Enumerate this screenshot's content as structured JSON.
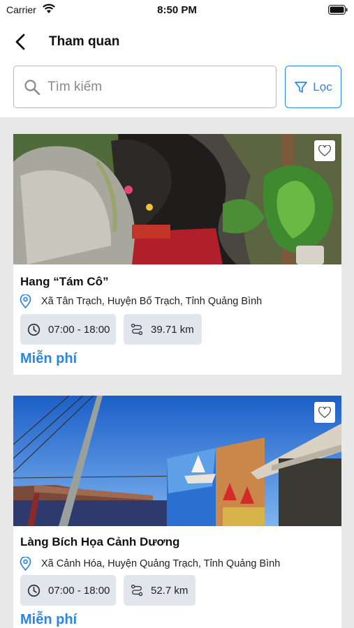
{
  "status_bar": {
    "carrier": "Carrier",
    "time": "8:50 PM"
  },
  "header": {
    "title": "Tham quan"
  },
  "search": {
    "placeholder": "Tìm kiếm",
    "value": ""
  },
  "filter": {
    "label": "Lọc"
  },
  "accent_color": "#2a86e0",
  "places": [
    {
      "name": "Hang “Tám Cô”",
      "address": "Xã Tân Trạch, Huyện Bố Trạch, Tỉnh Quảng Bình",
      "hours": "07:00 - 18:00",
      "distance": "39.71 km",
      "price": "Miễn phí",
      "favorite": false
    },
    {
      "name": "Làng Bích Họa Cảnh Dương",
      "address": "Xã Cảnh Hóa, Huyện Quảng Trạch, Tỉnh Quảng Bình",
      "hours": "07:00 - 18:00",
      "distance": "52.7 km",
      "price": "Miễn phí",
      "favorite": false
    }
  ]
}
